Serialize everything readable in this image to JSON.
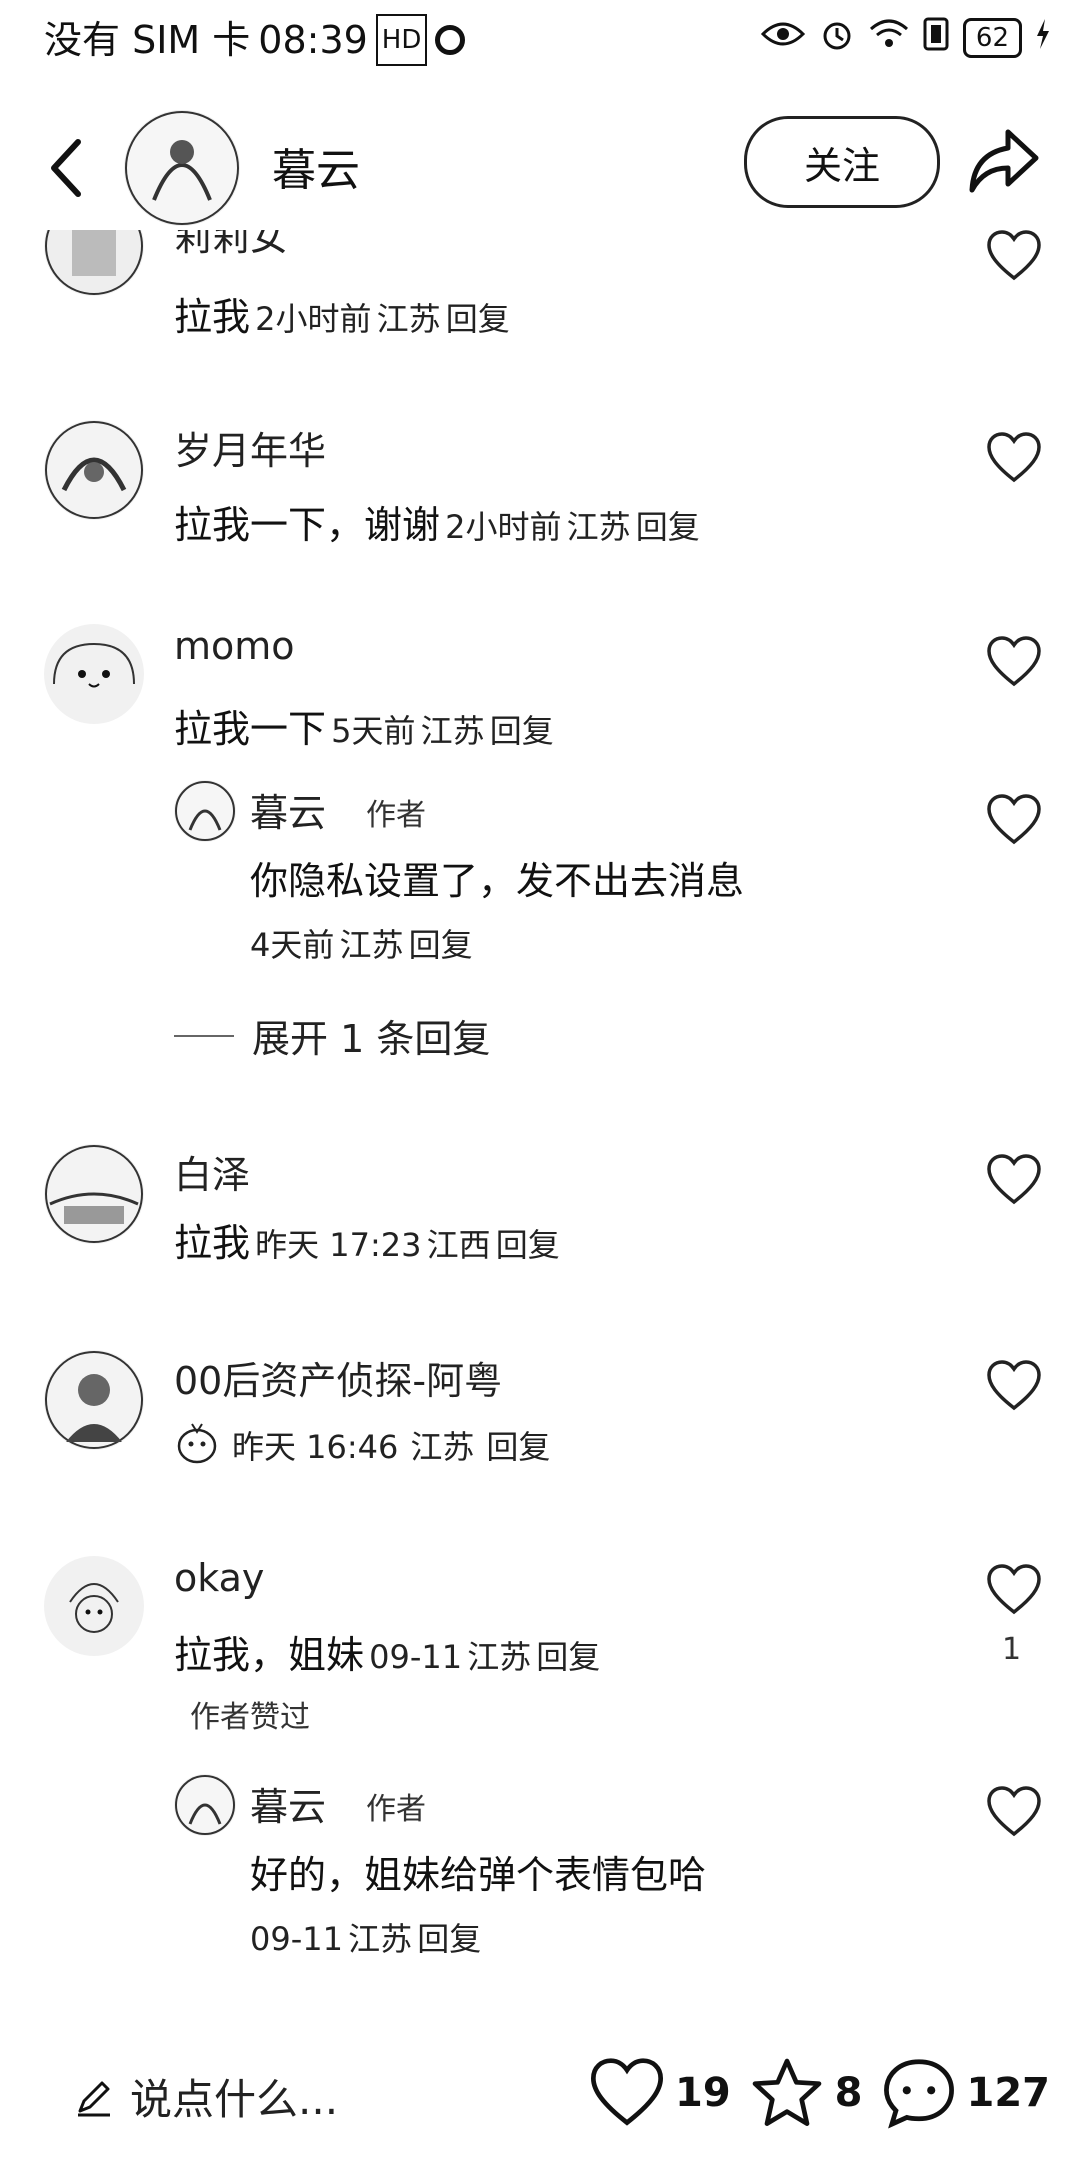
{
  "status_bar": {
    "carrier": "没有 SIM 卡",
    "time": "08:39",
    "battery": "62"
  },
  "header": {
    "name": "暮云",
    "follow_label": "关注",
    "icons": [
      "back-icon",
      "share-icon"
    ]
  },
  "comments": [
    {
      "name": "莉莉女",
      "text": "拉我",
      "time": "2小时前",
      "location": "江苏",
      "reply": "回复"
    },
    {
      "name": "岁月年华",
      "text": "拉我一下，谢谢",
      "time": "2小时前",
      "location": "江苏",
      "reply": "回复"
    },
    {
      "name": "momo",
      "text": "拉我一下",
      "time": "5天前",
      "location": "江苏",
      "reply": "回复",
      "sub": {
        "name": "暮云",
        "tag": "作者",
        "text": "你隐私设置了，发不出去消息",
        "time": "4天前",
        "location": "江苏",
        "reply": "回复"
      },
      "expand": "展开 1 条回复"
    },
    {
      "name": "白泽",
      "text": "拉我",
      "time": "昨天 17:23",
      "location": "江西",
      "reply": "回复"
    },
    {
      "name": "00后资产侦探-阿粤",
      "text": "",
      "time": "昨天 16:46",
      "location": "江苏",
      "reply": "回复"
    },
    {
      "name": "okay",
      "text": "拉我，姐妹",
      "time": "09-11",
      "location": "江苏",
      "reply": "回复",
      "likes": "1",
      "badge": "作者赞过",
      "sub": {
        "name": "暮云",
        "tag": "作者",
        "text": "好的，姐妹给弹个表情包哈",
        "time": "09-11",
        "location": "江苏",
        "reply": "回复"
      }
    }
  ],
  "bottom_bar": {
    "placeholder": "说点什么...",
    "likes": "19",
    "favorites": "8",
    "comments": "127"
  }
}
